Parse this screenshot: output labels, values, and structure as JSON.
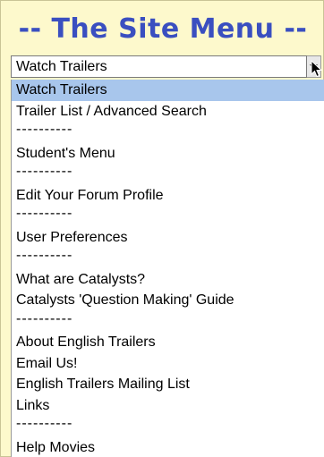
{
  "menu": {
    "title": "-- The Site Menu --",
    "selected_value": "Watch Trailers",
    "options": [
      {
        "label": "Watch Trailers",
        "selected": true
      },
      {
        "label": "Trailer List / Advanced Search"
      },
      {
        "label": "----------"
      },
      {
        "label": "Student's Menu"
      },
      {
        "label": "----------"
      },
      {
        "label": "Edit Your Forum Profile"
      },
      {
        "label": "----------"
      },
      {
        "label": "User Preferences"
      },
      {
        "label": "----------"
      },
      {
        "label": "What are Catalysts?"
      },
      {
        "label": "Catalysts 'Question Making' Guide"
      },
      {
        "label": "----------"
      },
      {
        "label": "About English Trailers"
      },
      {
        "label": "Email Us!"
      },
      {
        "label": "English Trailers Mailing List"
      },
      {
        "label": "Links"
      },
      {
        "label": "----------"
      },
      {
        "label": "Help Movies"
      }
    ]
  },
  "icons": {
    "dropdown_arrow": "chevron-down-icon",
    "pointer": "cursor-arrow-icon"
  },
  "colors": {
    "panel_background": "#fdf9cc",
    "title": "#3a4fc0",
    "selected_option": "#a8c6ec"
  }
}
